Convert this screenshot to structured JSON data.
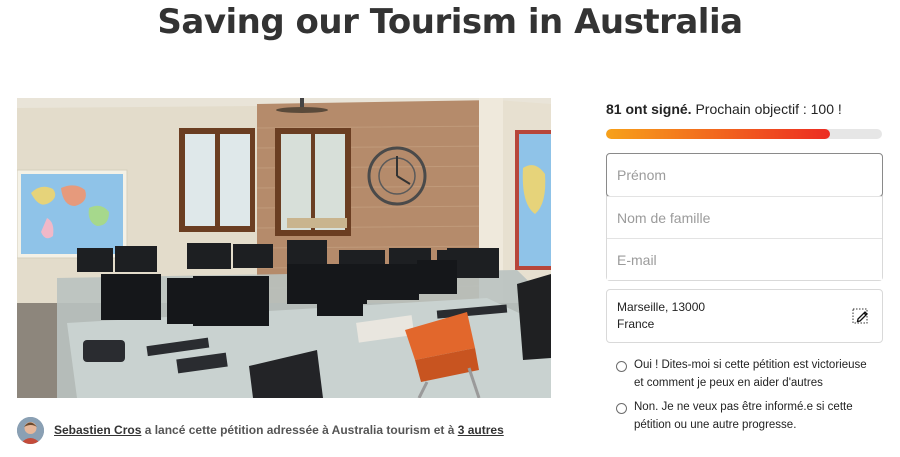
{
  "page": {
    "title": "Saving our Tourism in Australia"
  },
  "author": {
    "name": "Sebastien Cros",
    "text_middle": " a lancé cette pétition adressée à Australia tourism et à ",
    "others_link": "3 autres"
  },
  "signatures": {
    "count_label": "81 ont signé.",
    "goal_label": " Prochain objectif : 100 !",
    "progress_fraction": 0.81,
    "progress_colors": [
      "#f7a11a",
      "#ec2c22"
    ]
  },
  "form": {
    "first_name_placeholder": "Prénom",
    "last_name_placeholder": "Nom de famille",
    "email_placeholder": "E-mail",
    "location_line1": "Marseille, 13000",
    "location_line2": "France",
    "edit_icon": "pencil-edit-icon"
  },
  "options": [
    {
      "label": "Oui ! Dites-moi si cette pétition est victorieuse et comment je peux en aider d'autres"
    },
    {
      "label": "Non. Je ne veux pas être informé.e si cette pétition ou une autre progresse."
    }
  ],
  "photo": {
    "subject": "office-interior-photo"
  }
}
